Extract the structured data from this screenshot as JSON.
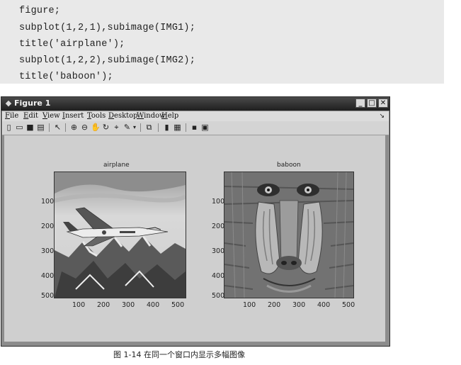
{
  "code_lines": [
    "figure;",
    "subplot(1,2,1),subimage(IMG1);",
    "title('airplane');",
    "subplot(1,2,2),subimage(IMG2);",
    "title('baboon');"
  ],
  "window": {
    "title": "Figure 1",
    "buttons": {
      "minimize": "_",
      "maximize": "□",
      "close": "✕"
    },
    "menu": [
      "File",
      "Edit",
      "View",
      "Insert",
      "Tools",
      "Desktop",
      "Window",
      "Help"
    ],
    "menu_overflow": "↘"
  },
  "toolbar_icons": [
    "new-figure-icon",
    "open-icon",
    "save-icon",
    "print-icon",
    "arrow-pointer-icon",
    "zoom-in-icon",
    "zoom-out-icon",
    "pan-icon",
    "rotate-3d-icon",
    "data-cursor-icon",
    "brush-icon",
    "link-plot-icon",
    "colorbar-icon",
    "legend-icon",
    "hide-plot-tools-icon",
    "show-plot-tools-icon"
  ],
  "plots": [
    {
      "title": "airplane",
      "image": "airplane-photo",
      "y_ticks": [
        "100",
        "200",
        "300",
        "400",
        "500"
      ],
      "x_ticks": [
        "100",
        "200",
        "300",
        "400",
        "500"
      ]
    },
    {
      "title": "baboon",
      "image": "baboon-photo",
      "y_ticks": [
        "100",
        "200",
        "300",
        "400",
        "500"
      ],
      "x_ticks": [
        "100",
        "200",
        "300",
        "400",
        "500"
      ]
    }
  ],
  "caption": "图 1-14   在同一个窗口内显示多幅图像"
}
